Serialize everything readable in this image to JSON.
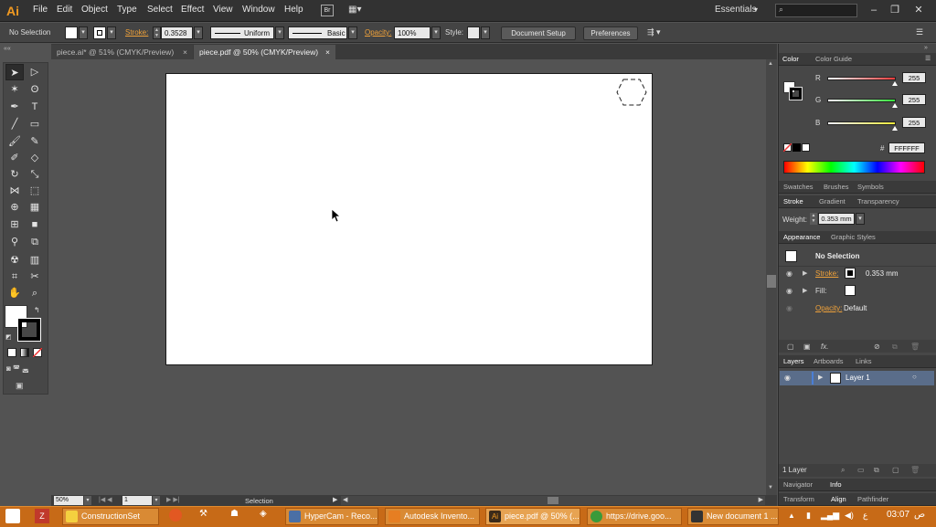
{
  "app": {
    "logo": "Ai",
    "menus": [
      "File",
      "Edit",
      "Object",
      "Type",
      "Select",
      "Effect",
      "View",
      "Window",
      "Help"
    ],
    "workspace": "Essentials",
    "window_controls": [
      "–",
      "❐",
      "✕"
    ]
  },
  "control_bar": {
    "selection": "No Selection",
    "stroke_label": "Stroke:",
    "stroke_value": "0.3528 m",
    "profile": "Uniform",
    "brush": "Basic",
    "opacity_label": "Opacity:",
    "opacity_value": "100%",
    "style_label": "Style:",
    "document_setup": "Document Setup",
    "preferences": "Preferences"
  },
  "tabs": [
    {
      "label": "piece.ai* @ 51% (CMYK/Preview)",
      "close": "×"
    },
    {
      "label": "piece.pdf @ 50% (CMYK/Preview)",
      "close": "×"
    }
  ],
  "status": {
    "zoom": "50%",
    "page": "1",
    "tool": "Selection"
  },
  "color_panel": {
    "tabs": [
      "Color",
      "Color Guide"
    ],
    "r_label": "R",
    "r_value": "255",
    "g_label": "G",
    "g_value": "255",
    "b_label": "B",
    "b_value": "255",
    "hex_label": "#",
    "hex_value": "FFFFFF",
    "r_color": "#ff3b3b",
    "g_color": "#36e63b",
    "b_color": "#f3e93a"
  },
  "swatches_tabs": [
    "Swatches",
    "Brushes",
    "Symbols"
  ],
  "stroke_panel": {
    "tabs": [
      "Stroke",
      "Gradient",
      "Transparency"
    ],
    "weight_label": "Weight:",
    "weight_value": "0.353 mm"
  },
  "appearance_panel": {
    "tabs": [
      "Appearance",
      "Graphic Styles"
    ],
    "title": "No Selection",
    "stroke_label": "Stroke:",
    "stroke_value": "0.353 mm",
    "fill_label": "Fill:",
    "opacity_label": "Opacity:",
    "opacity_value": "Default",
    "fx": "fx."
  },
  "layers_panel": {
    "tabs": [
      "Layers",
      "Artboards",
      "Links"
    ],
    "layer_name": "Layer 1",
    "count": "1 Layer"
  },
  "bottom_tabs_1": [
    "Navigator",
    "Info"
  ],
  "bottom_tabs_2": [
    "Transform",
    "Align",
    "Pathfinder"
  ],
  "taskbar": {
    "items": [
      {
        "label": "ConstructionSet",
        "icon_color": "#f4d03f"
      },
      {
        "label": "HyperCam - Reco...",
        "icon_color": "#4a6fa5"
      },
      {
        "label": "Autodesk Invento...",
        "icon_color": "#e67e22"
      },
      {
        "label": "piece.pdf @ 50% (...",
        "icon_color": "#3b2b1a"
      },
      {
        "label": "https://drive.goo...",
        "icon_color": "#3a9a3a"
      },
      {
        "label": "New document 1 ...",
        "icon_color": "#333333"
      }
    ],
    "lang": "ع",
    "time": "03:07",
    "ampm": "ص"
  }
}
